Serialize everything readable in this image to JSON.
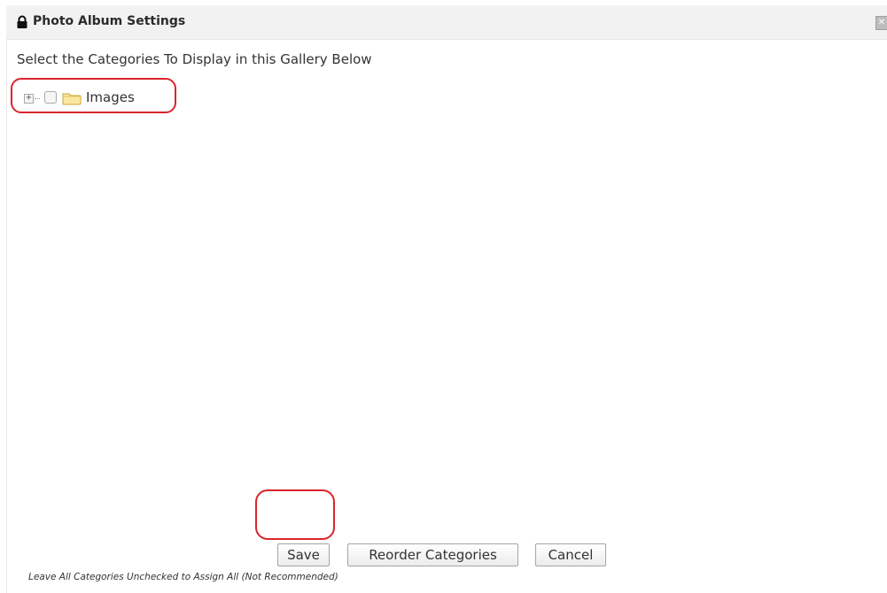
{
  "dialog": {
    "title": "Photo Album Settings",
    "title_icon": "lock-icon",
    "close_icon": "close-icon",
    "close_glyph": "✕"
  },
  "content": {
    "instruction": "Select the Categories To Display in this Gallery Below",
    "tree": [
      {
        "label": "Images",
        "expander": "+",
        "checked": false,
        "icon": "folder-icon",
        "expanded": false
      }
    ]
  },
  "buttons": {
    "save": "Save",
    "reorder": "Reorder Categories",
    "cancel": "Cancel"
  },
  "footnote": "Leave All Categories Unchecked to Assign All (Not Recommended)",
  "colors": {
    "highlight": "#d9252d",
    "titlebar_bg": "#f2f2f2",
    "folder_fill": "#fbe7a1",
    "folder_stroke": "#c9a43a"
  }
}
